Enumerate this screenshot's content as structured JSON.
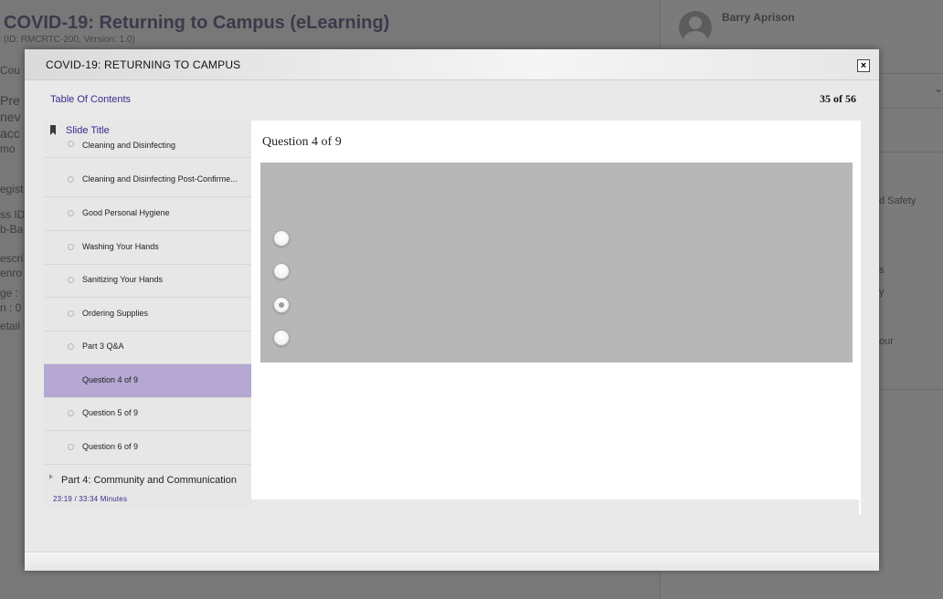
{
  "background": {
    "course_title": "COVID-19: Returning to Campus (eLearning)",
    "course_subtitle": "(ID: RMCRTC-200, Version: 1.0)",
    "user_name": "Barry Aprison",
    "left_snippets": [
      "Cou",
      "Pre",
      "nev",
      "acc",
      "mo",
      "egist",
      "ss ID",
      "b-Ba",
      "escri",
      "enro",
      "ge :",
      "n : 0",
      "etail"
    ],
    "right_snippets": [
      "d Safety",
      "s",
      "y",
      "our"
    ]
  },
  "modal": {
    "title": "COVID-19: RETURNING TO CAMPUS",
    "close_label": "×",
    "toc_link": "Table Of Contents",
    "slide_counter": "35 of 56"
  },
  "sidebar": {
    "slide_title": "Slide Title",
    "items": [
      {
        "label": "Cleaning and Disinfecting",
        "active": false
      },
      {
        "label": "Cleaning and Disinfecting Post-Confirme...",
        "active": false
      },
      {
        "label": "Good Personal Hygiene",
        "active": false
      },
      {
        "label": "Washing Your Hands",
        "active": false
      },
      {
        "label": "Sanitizing Your Hands",
        "active": false
      },
      {
        "label": "Ordering Supplies",
        "active": false
      },
      {
        "label": "Part 3 Q&A",
        "active": false
      },
      {
        "label": "Question 4 of 9",
        "active": true
      },
      {
        "label": "Question 5 of 9",
        "active": false
      },
      {
        "label": "Question 6 of 9",
        "active": false
      }
    ],
    "part_label": "Part 4: Community and Communication",
    "timer": "23:19 / 33:34 Minutes"
  },
  "slide": {
    "question_heading": "Question 4 of 9",
    "options": [
      {
        "selected": false
      },
      {
        "selected": false
      },
      {
        "selected": true
      },
      {
        "selected": false
      }
    ]
  },
  "colors": {
    "accent_text": "#3b2a8e",
    "active_item": "#b5a8d3",
    "question_box": "#b7b7b7"
  }
}
